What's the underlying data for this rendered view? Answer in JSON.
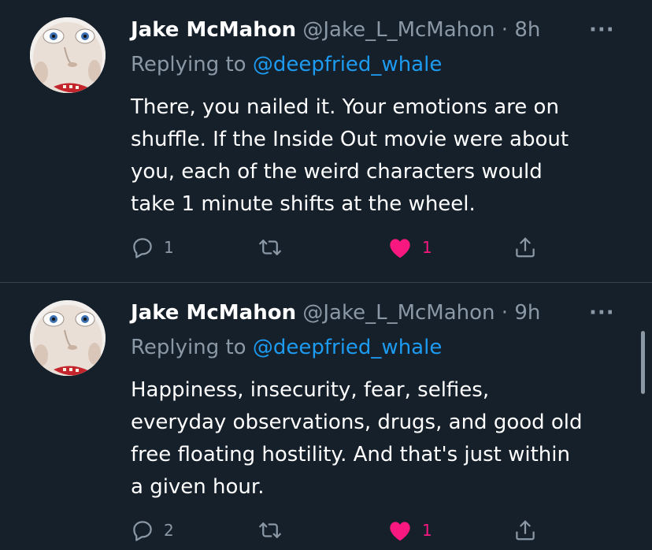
{
  "colors": {
    "background": "#15202b",
    "secondary_text": "#8b98a5",
    "link": "#1d9bf0",
    "like": "#f91880",
    "divider": "#38444d"
  },
  "tweets": [
    {
      "name": "Jake McMahon",
      "handle": "@Jake_L_McMahon",
      "dot": "·",
      "time": "8h",
      "more": "···",
      "replying_prefix": "Replying to",
      "replying_to": "@deepfried_whale",
      "text": "There, you nailed it. Your emotions are on\nshuffle. If the Inside Out movie were about\nyou, each of the weird characters would\ntake 1 minute shifts at the wheel.",
      "reply_count": "1",
      "retweet_count": "",
      "like_count": "1",
      "liked": true,
      "icons": [
        "reply-icon",
        "retweet-icon",
        "heart-filled-icon",
        "share-icon"
      ]
    },
    {
      "name": "Jake McMahon",
      "handle": "@Jake_L_McMahon",
      "dot": "·",
      "time": "9h",
      "more": "···",
      "replying_prefix": "Replying to",
      "replying_to": "@deepfried_whale",
      "text": "Happiness, insecurity, fear, selfies,\neveryday observations, drugs, and good old\nfree floating hostility. And that's just within\na given hour.",
      "reply_count": "2",
      "retweet_count": "",
      "like_count": "1",
      "liked": true,
      "icons": [
        "reply-icon",
        "retweet-icon",
        "heart-filled-icon",
        "share-icon"
      ]
    }
  ]
}
